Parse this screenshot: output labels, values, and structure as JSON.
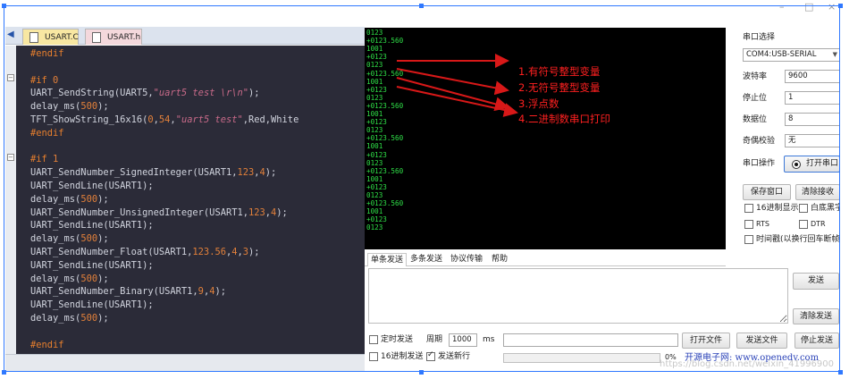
{
  "window": {
    "controls": [
      "–",
      "□",
      "×"
    ]
  },
  "editor": {
    "tabs": [
      {
        "label": "USART.C"
      },
      {
        "label": "USART.h"
      }
    ],
    "lines": [
      {
        "segs": [
          {
            "t": "#endif",
            "c": "kw"
          }
        ]
      },
      {
        "segs": []
      },
      {
        "segs": [
          {
            "t": "#if ",
            "c": "kw"
          },
          {
            "t": "0",
            "c": "num"
          }
        ]
      },
      {
        "segs": [
          {
            "t": "UART_SendString(UART5,",
            "c": ""
          },
          {
            "t": "\"uart5 test \\r\\n\"",
            "c": "str"
          },
          {
            "t": ");",
            "c": ""
          }
        ]
      },
      {
        "segs": [
          {
            "t": "delay_ms(",
            "c": ""
          },
          {
            "t": "500",
            "c": "num"
          },
          {
            "t": ");",
            "c": ""
          }
        ]
      },
      {
        "segs": [
          {
            "t": "TFT_ShowString_16x16(",
            "c": ""
          },
          {
            "t": "0",
            "c": "num"
          },
          {
            "t": ",",
            "c": ""
          },
          {
            "t": "54",
            "c": "num"
          },
          {
            "t": ",",
            "c": ""
          },
          {
            "t": "\"uart5 test\"",
            "c": "str"
          },
          {
            "t": ",Red,White",
            "c": ""
          }
        ]
      },
      {
        "segs": [
          {
            "t": "#endif",
            "c": "kw"
          }
        ]
      },
      {
        "segs": []
      },
      {
        "segs": [
          {
            "t": "#if ",
            "c": "kw"
          },
          {
            "t": "1",
            "c": "num"
          }
        ]
      },
      {
        "segs": [
          {
            "t": "UART_SendNumber_SignedInteger(USART1,",
            "c": ""
          },
          {
            "t": "123",
            "c": "num"
          },
          {
            "t": ",",
            "c": ""
          },
          {
            "t": "4",
            "c": "num"
          },
          {
            "t": ");",
            "c": ""
          }
        ]
      },
      {
        "segs": [
          {
            "t": "UART_SendLine(USART1);",
            "c": ""
          }
        ]
      },
      {
        "segs": [
          {
            "t": "delay_ms(",
            "c": ""
          },
          {
            "t": "500",
            "c": "num"
          },
          {
            "t": ");",
            "c": ""
          }
        ]
      },
      {
        "segs": [
          {
            "t": "UART_SendNumber_UnsignedInteger(USART1,",
            "c": ""
          },
          {
            "t": "123",
            "c": "num"
          },
          {
            "t": ",",
            "c": ""
          },
          {
            "t": "4",
            "c": "num"
          },
          {
            "t": ");",
            "c": ""
          }
        ]
      },
      {
        "segs": [
          {
            "t": "UART_SendLine(USART1);",
            "c": ""
          }
        ]
      },
      {
        "segs": [
          {
            "t": "delay_ms(",
            "c": ""
          },
          {
            "t": "500",
            "c": "num"
          },
          {
            "t": ");",
            "c": ""
          }
        ]
      },
      {
        "segs": [
          {
            "t": "UART_SendNumber_Float(USART1,",
            "c": ""
          },
          {
            "t": "123.56",
            "c": "num"
          },
          {
            "t": ",",
            "c": ""
          },
          {
            "t": "4",
            "c": "num"
          },
          {
            "t": ",",
            "c": ""
          },
          {
            "t": "3",
            "c": "num"
          },
          {
            "t": ");",
            "c": ""
          }
        ]
      },
      {
        "segs": [
          {
            "t": "UART_SendLine(USART1);",
            "c": ""
          }
        ]
      },
      {
        "segs": [
          {
            "t": "delay_ms(",
            "c": ""
          },
          {
            "t": "500",
            "c": "num"
          },
          {
            "t": ");",
            "c": ""
          }
        ]
      },
      {
        "segs": [
          {
            "t": "UART_SendNumber_Binary(USART1,",
            "c": ""
          },
          {
            "t": "9",
            "c": "num"
          },
          {
            "t": ",",
            "c": ""
          },
          {
            "t": "4",
            "c": "num"
          },
          {
            "t": ");",
            "c": ""
          }
        ]
      },
      {
        "segs": [
          {
            "t": "UART_SendLine(USART1);",
            "c": ""
          }
        ]
      },
      {
        "segs": [
          {
            "t": "delay_ms(",
            "c": ""
          },
          {
            "t": "500",
            "c": "num"
          },
          {
            "t": ");",
            "c": ""
          }
        ]
      },
      {
        "segs": []
      },
      {
        "segs": [
          {
            "t": "#endif",
            "c": "kw"
          }
        ]
      }
    ]
  },
  "receive": {
    "lines": [
      "0123",
      "+0123.560",
      "1001",
      "+0123",
      "0123",
      "+0123.560",
      "1001",
      "+0123",
      "0123",
      "+0123.560",
      "1001",
      "+0123",
      "0123",
      "+0123.560",
      "1001",
      "+0123",
      "0123",
      "+0123.560",
      "1001",
      "+0123",
      "0123",
      "+0123.560",
      "1001",
      "+0123",
      "0123"
    ],
    "annotations": [
      "1.有符号整型变量",
      "2.无符号整型变量",
      "3.浮点数",
      "4.二进制数串口打印"
    ]
  },
  "send_tabs": [
    "单条发送",
    "多条发送",
    "协议传输",
    "帮助"
  ],
  "port_panel": {
    "title": "串口选择",
    "port": "COM4:USB-SERIAL",
    "baud_label": "波特率",
    "baud": "9600",
    "stop_label": "停止位",
    "stop": "1",
    "data_label": "数据位",
    "data": "8",
    "parity_label": "奇偶校验",
    "parity": "无",
    "op_label": "串口操作",
    "open_btn": "打开串口",
    "save_btn": "保存窗口",
    "clear_rx_btn": "清除接收",
    "hex_show": "16进制显示",
    "white_bg": "白底黑字",
    "rts": "RTS",
    "dtr": "DTR",
    "timestamp": "时间戳(以换行回车断帧)"
  },
  "send_panel": {
    "send_btn": "发送",
    "clear_send_btn": "清除发送",
    "timed_send": "定时发送",
    "period_label": "周期",
    "period": "1000",
    "period_unit": "ms",
    "open_file_btn": "打开文件",
    "send_file_btn": "发送文件",
    "stop_send_btn": "停止发送",
    "hex_send": "16进制发送",
    "send_newline": "发送新行",
    "percent": "0%"
  },
  "footer": {
    "site": "开源电子网: www.openedv.com",
    "watermark": "https://blog.csdn.net/weixin_41996900"
  },
  "colors": {
    "rx_text": "#2fe048",
    "annotation": "#ff2020",
    "code_bg": "#2b2b38",
    "keyword": "#e77f2d",
    "string": "#c86a89"
  }
}
